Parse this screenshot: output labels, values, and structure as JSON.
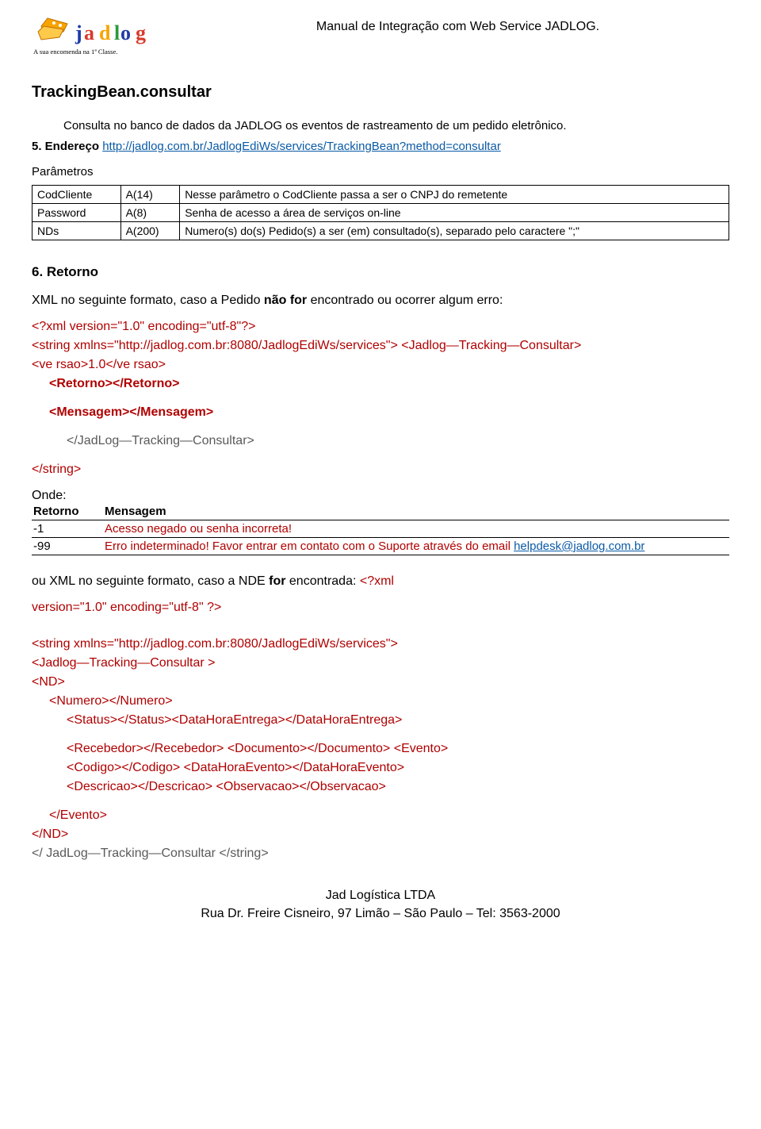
{
  "header": {
    "logo_tagline": "A sua encomenda na 1ª Classe.",
    "title": "Manual de Integração com Web Service JADLOG."
  },
  "section": {
    "title": "TrackingBean.consultar",
    "intro": "Consulta no banco de dados da JADLOG os eventos de rastreamento de um pedido eletrônico.",
    "addr_label": "5. Endereço ",
    "addr_url": "http://jadlog.com.br/JadlogEdiWs/services/TrackingBean?method=consultar",
    "params_label": "Parâmetros"
  },
  "params": [
    {
      "name": "CodCliente",
      "type": "A(14)",
      "desc": "Nesse parâmetro o CodCliente passa a ser o CNPJ do remetente"
    },
    {
      "name": "Password",
      "type": "A(8)",
      "desc": "Senha de acesso a área de serviços on-line"
    },
    {
      "name": "NDs",
      "type": "A(200)",
      "desc": "Numero(s) do(s) Pedido(s) a ser (em) consultado(s), separado pelo caractere \";\""
    }
  ],
  "retorno": {
    "heading": "6. Retorno",
    "intro_prefix": "XML no seguinte formato, caso a Pedido ",
    "intro_bold": "não for",
    "intro_suffix": " encontrado ou ocorrer algum erro:",
    "xml_decl": "<?xml version=\"1.0\" encoding=\"utf-8\"?>",
    "string_open": "<string xmlns=\"http://jadlog.com.br:8080/JadlogEdiWs/services\"> <Jadlog—Tracking—Consultar>",
    "versao": "<ve rsao>1.0</ve rsao>",
    "retorno_tag": "<Retorno></Retorno>",
    "mensagem_tag": "<Mensagem></Mensagem>",
    "close1": "</JadLog—Tracking—Consultar>",
    "close_string": "</string>",
    "onde": "Onde:",
    "table_h1": "Retorno",
    "table_h2": "Mensagem",
    "rows": [
      {
        "code": "-1",
        "msg": "Acesso negado ou senha incorreta!"
      },
      {
        "code": "-99",
        "msg": "Erro indeterminado! Favor entrar em contato com o Suporte através do email ",
        "link": "helpdesk@jadlog.com.br"
      }
    ],
    "found_intro_prefix": "ou XML no seguinte formato, caso a NDE ",
    "found_intro_bold": "for",
    "found_intro_suffix_before": " encontrada: ",
    "xml2_p1": "<?xml",
    "xml2_p2": "version=\"1.0\" encoding=\"utf-8\" ?>",
    "xml2_string": "<string xmlns=\"http://jadlog.com.br:8080/JadlogEdiWs/services\">",
    "xml2_root": "<Jadlog—Tracking—Consultar >",
    "xml2_nd": "<ND>",
    "xml2_num": "<Numero></Numero>",
    "xml2_status": "<Status></Status><DataHoraEntrega></DataHoraEntrega>",
    "xml2_receb": "<Recebedor></Recebedor> <Documento></Documento> <Evento>",
    "xml2_cod": "<Codigo></Codigo> <DataHoraEvento></DataHoraEvento>",
    "xml2_desc": "<Descricao></Descricao> <Observacao></Observacao>",
    "xml2_evento_close": "</Evento>",
    "xml2_nd_close": "</ND>",
    "xml2_close": "</ JadLog—Tracking—Consultar </string>"
  },
  "footer": {
    "line1": "Jad Logística LTDA",
    "line2": "Rua Dr. Freire Cisneiro, 97 Limão – São Paulo – Tel: 3563-2000"
  }
}
